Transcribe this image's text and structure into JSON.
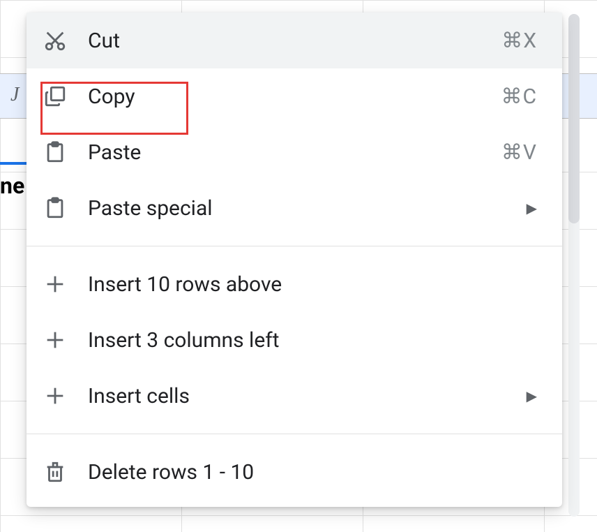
{
  "sheet": {
    "column_letter": "J",
    "visible_cell_text": "ne"
  },
  "menu": {
    "cut": {
      "label": "Cut",
      "shortcut": "⌘X"
    },
    "copy": {
      "label": "Copy",
      "shortcut": "⌘C"
    },
    "paste": {
      "label": "Paste",
      "shortcut": "⌘V"
    },
    "paste_special": {
      "label": "Paste special"
    },
    "insert_rows_above": {
      "label": "Insert 10 rows above"
    },
    "insert_cols_left": {
      "label": "Insert 3 columns left"
    },
    "insert_cells": {
      "label": "Insert cells"
    },
    "delete_rows": {
      "label": "Delete rows 1 - 10"
    }
  }
}
